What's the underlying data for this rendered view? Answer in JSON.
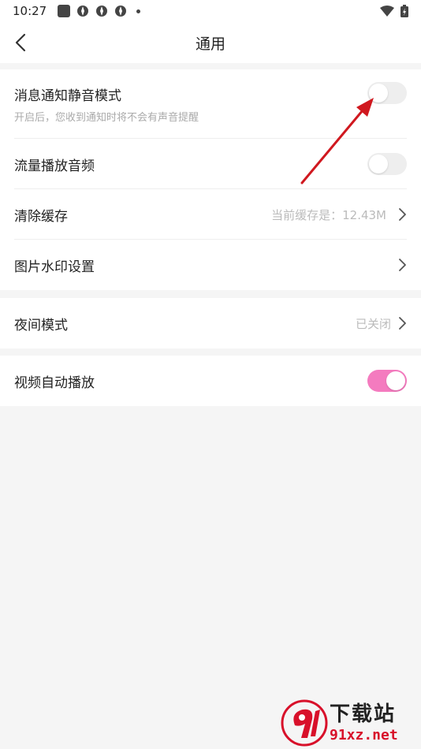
{
  "status_bar": {
    "time": "10:27"
  },
  "header": {
    "title": "通用"
  },
  "group1": {
    "rows": [
      {
        "label": "消息通知静音模式",
        "subtitle": "开启后，您收到通知时将不会有声音提醒",
        "toggle": "off"
      },
      {
        "label": "流量播放音频",
        "toggle": "off"
      },
      {
        "label": "清除缓存",
        "value": "当前缓存是：12.43M"
      },
      {
        "label": "图片水印设置"
      }
    ]
  },
  "group2": {
    "rows": [
      {
        "label": "夜间模式",
        "value": "已关闭"
      }
    ]
  },
  "group3": {
    "rows": [
      {
        "label": "视频自动播放",
        "toggle": "on"
      }
    ]
  },
  "colors": {
    "accent_pink": "#f47bbf",
    "annotation_arrow": "#d0181f"
  },
  "watermark": {
    "main": "下载站",
    "sub": "91xz.net"
  }
}
